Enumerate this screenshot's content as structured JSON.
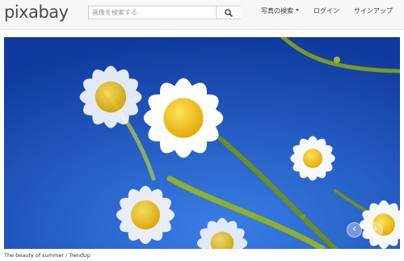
{
  "header": {
    "logo_text": "pixabay",
    "search": {
      "placeholder": "画像を検索する",
      "value": ""
    },
    "nav": {
      "photos_label": "写真の検索",
      "login_label": "ログイン",
      "signup_label": "サインアップ"
    }
  },
  "hero": {
    "image_alt": "daisy flowers against a blue sky",
    "caption_title": "The beauty of summer",
    "caption_separator": "/",
    "caption_author": "TrendUp"
  },
  "colors": {
    "sky": "#1b56c8",
    "petal": "#ffffff",
    "center": "#f2c21a",
    "stem": "#7fa21e"
  },
  "icons": {
    "search": "search-icon",
    "prev": "chevron-left-icon",
    "next": "chevron-right-icon",
    "dropdown": "caret-down-icon"
  }
}
